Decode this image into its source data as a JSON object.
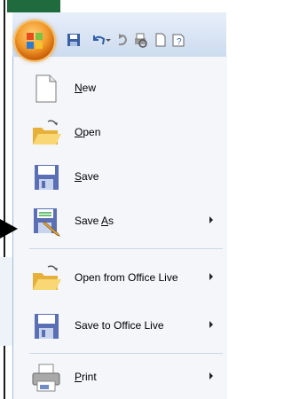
{
  "toolbar": {
    "office_button": "office-button",
    "quick_icons": [
      "save-icon",
      "undo-icon",
      "dropdown-icon",
      "redo-icon",
      "print-preview-icon",
      "new-icon",
      "help-icon"
    ]
  },
  "menu": {
    "items": [
      {
        "label": "New",
        "mnemonic": "N",
        "rest": "ew",
        "icon": "new-document-icon"
      },
      {
        "label": "Open",
        "mnemonic": "O",
        "rest": "pen",
        "icon": "open-folder-icon"
      },
      {
        "label": "Save",
        "mnemonic": "S",
        "rest": "ave",
        "icon": "save-disk-icon"
      },
      {
        "label": "Save As",
        "pre": "Save ",
        "mnemonic": "A",
        "rest": "s",
        "icon": "save-as-icon",
        "submenu": true
      },
      {
        "label": "Open from Office Live",
        "icon": "open-office-live-icon",
        "submenu": true
      },
      {
        "label": "Save to Office Live",
        "icon": "save-office-live-icon",
        "submenu": true
      },
      {
        "label": "Print",
        "mnemonic": "P",
        "rest": "rint",
        "icon": "printer-icon",
        "submenu": true
      }
    ]
  }
}
